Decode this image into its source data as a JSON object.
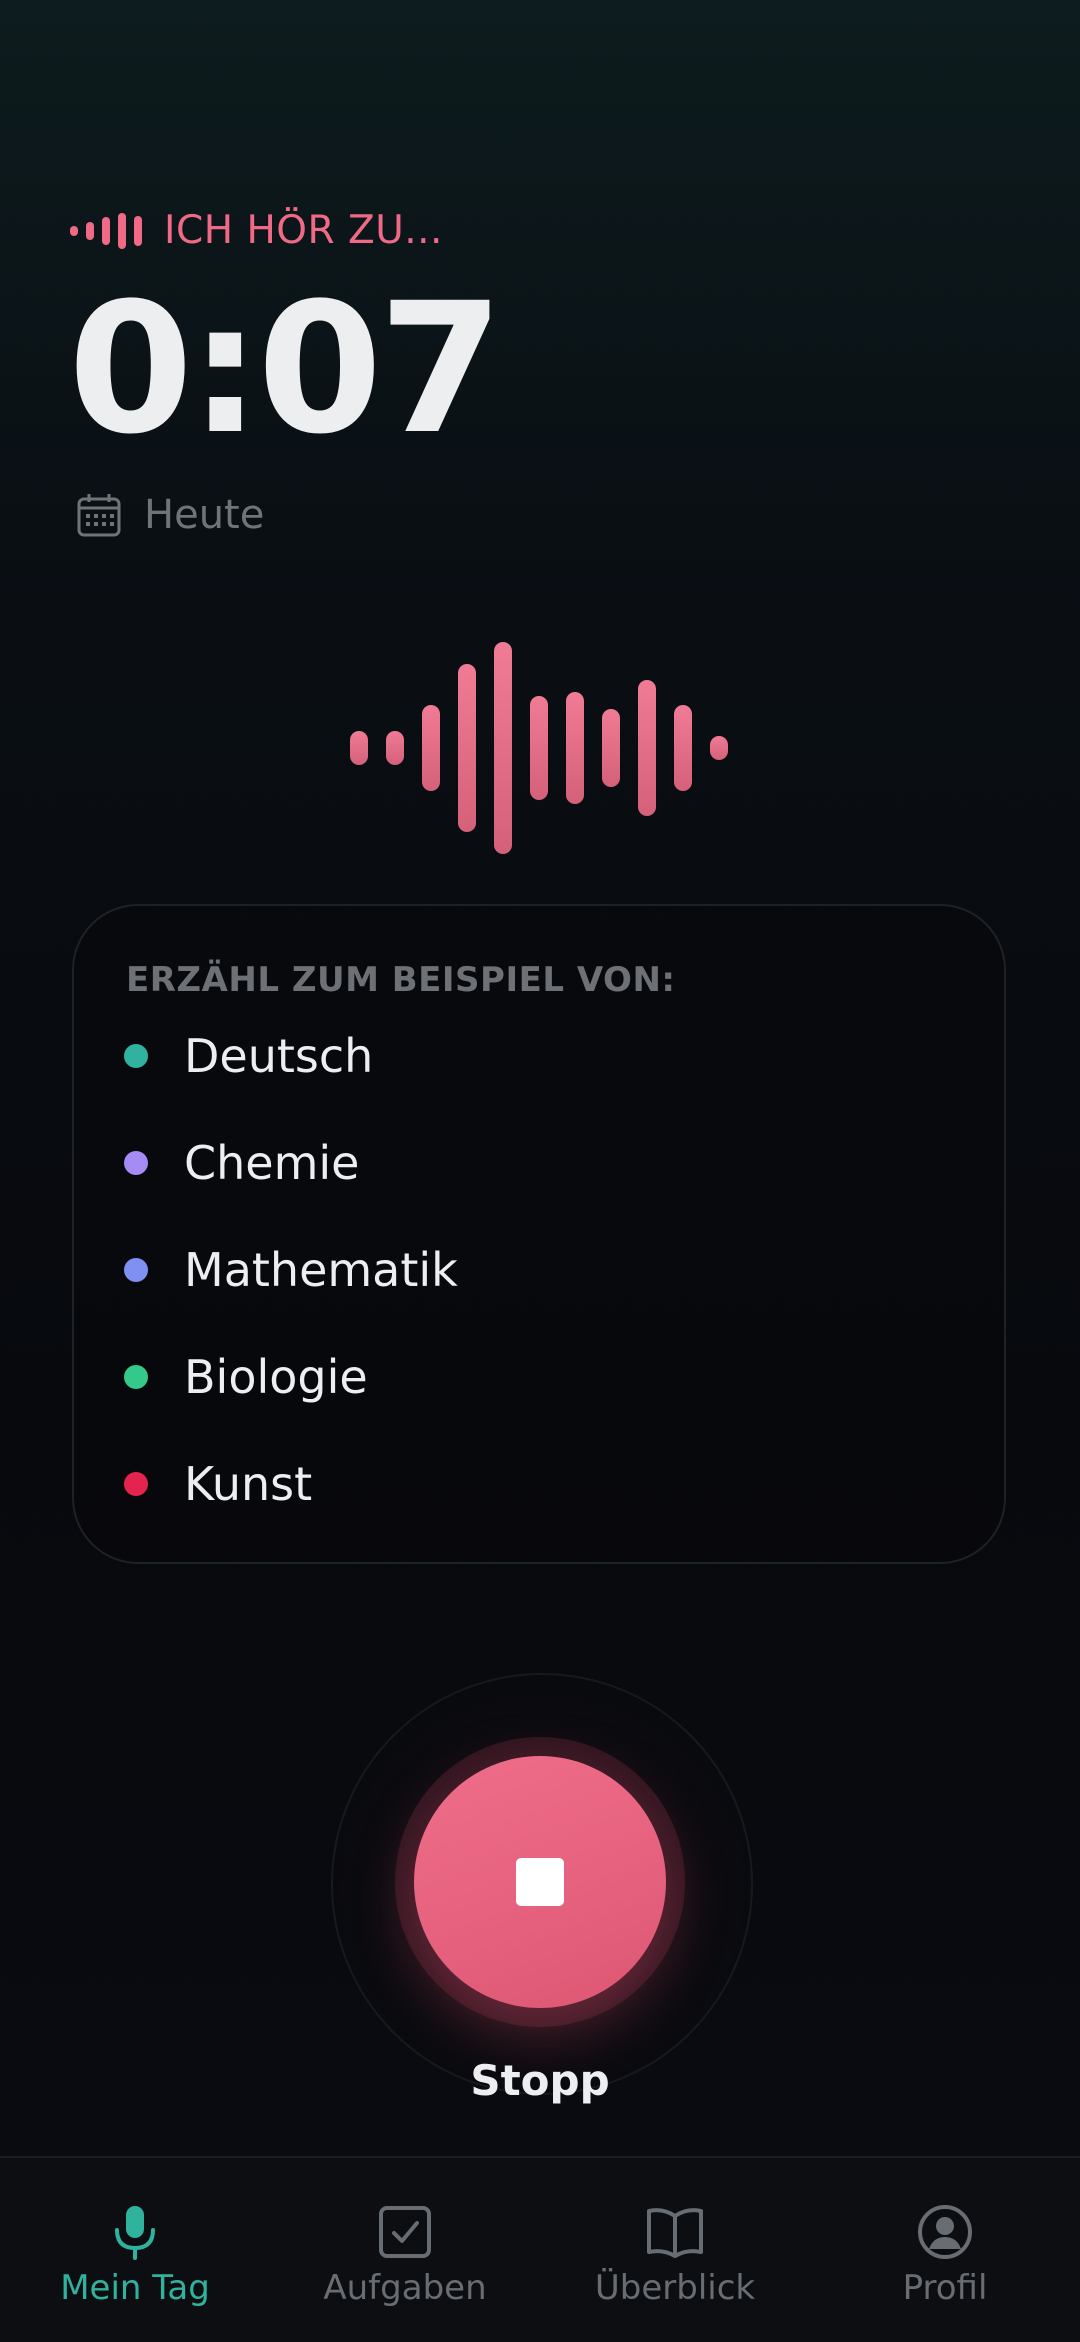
{
  "recording": {
    "status_text": "ICH HÖR ZU...",
    "timer": "0:07",
    "date_label": "Heute",
    "accent_color": "#f06a86"
  },
  "suggestions": {
    "title": "ERZÄHL ZUM BEISPIEL VON:",
    "items": [
      {
        "label": "Deutsch",
        "color": "#2fb39e"
      },
      {
        "label": "Chemie",
        "color": "#a58cf5"
      },
      {
        "label": "Mathematik",
        "color": "#8090f2"
      },
      {
        "label": "Biologie",
        "color": "#34c98a"
      },
      {
        "label": "Kunst",
        "color": "#e4234f"
      }
    ]
  },
  "stop": {
    "label": "Stopp",
    "icon": "stop-icon"
  },
  "nav": {
    "active_color": "#2fb39e",
    "items": [
      {
        "label": "Mein Tag",
        "icon": "microphone-icon",
        "active": true
      },
      {
        "label": "Aufgaben",
        "icon": "checkbox-icon",
        "active": false
      },
      {
        "label": "Überblick",
        "icon": "book-icon",
        "active": false
      },
      {
        "label": "Profil",
        "icon": "user-icon",
        "active": false
      }
    ]
  }
}
